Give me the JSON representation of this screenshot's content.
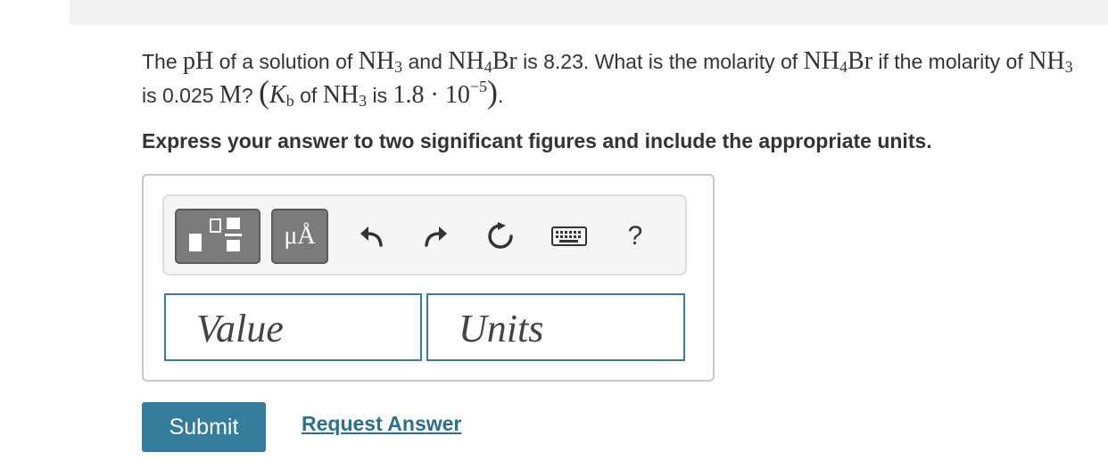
{
  "question": {
    "t1": "The ",
    "pH": "pH",
    "t2": " of a solution of ",
    "nh3_a": "NH",
    "nh3_a_sub": "3",
    "t3": " and ",
    "nh4br_a1": "NH",
    "nh4br_a_sub": "4",
    "nh4br_a2": "Br",
    "t4": " is 8.23. What is the molarity of ",
    "nh4br_b1": "NH",
    "nh4br_b_sub": "4",
    "nh4br_b2": "Br",
    "t5": " if the molarity of ",
    "nh3_b": "NH",
    "nh3_b_sub": "3",
    "t6": " is 0.025 ",
    "M": "M",
    "t7": "? ",
    "paren_open": "(",
    "K": "K",
    "K_sub": "b",
    "t8": " of ",
    "nh3_c": "NH",
    "nh3_c_sub": "3",
    "t9": " is ",
    "kb_value": "1.8 · 10",
    "kb_exp": "−5",
    "paren_close": ")",
    "t10": "."
  },
  "instruction": "Express your answer to two significant figures and include the appropriate units.",
  "toolbar": {
    "units_label": "μÅ",
    "help_label": "?"
  },
  "fields": {
    "value_placeholder": "Value",
    "units_placeholder": "Units"
  },
  "actions": {
    "submit": "Submit",
    "request_answer": "Request Answer"
  },
  "colors": {
    "accent": "#357c9c",
    "link": "#2b6e8e",
    "field_border": "#3d7c97",
    "toolbar_button": "#7b7b7b"
  }
}
